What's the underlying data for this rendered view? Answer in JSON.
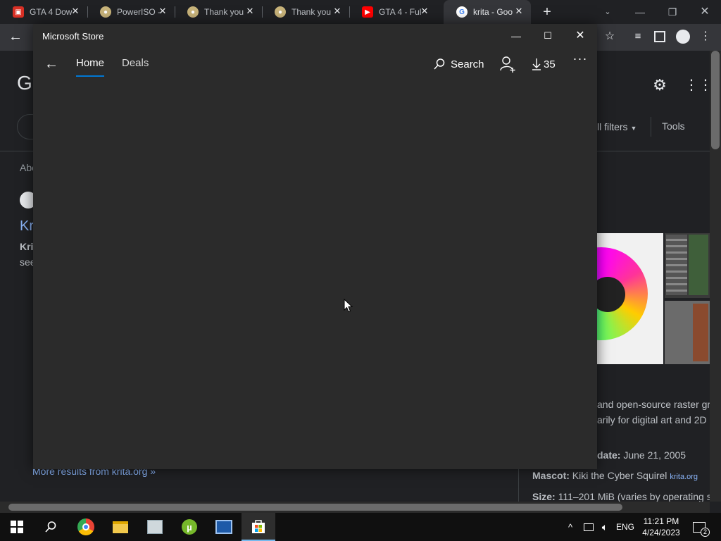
{
  "browser": {
    "tabs": [
      {
        "title": "GTA 4 Dow",
        "icon": "red-app-icon",
        "color": "#d93025"
      },
      {
        "title": "PowerISO -",
        "icon": "disc-icon",
        "color": "#c8b37a"
      },
      {
        "title": "Thank you",
        "icon": "disc-icon",
        "color": "#c8b37a"
      },
      {
        "title": "Thank you",
        "icon": "disc-icon",
        "color": "#c8b37a"
      },
      {
        "title": "GTA 4 - Ful",
        "icon": "youtube-icon",
        "color": "#ff0000"
      },
      {
        "title": "krita - Goo",
        "icon": "google-icon",
        "color": "#4285f4"
      }
    ],
    "new_tab_symbol": "+",
    "search_page": {
      "logo_letter": "G",
      "filters_label": "ll filters",
      "tools_label": "Tools",
      "about_fragment": "Abo",
      "result_title_fragment": "Kr",
      "result_bold_fragment": "Kri",
      "result_line_fragment": "see",
      "more_results": "More results from krita.org »",
      "kp_desc_line1": "and open-source raster gra",
      "kp_desc_line2": "arily for digital art and 2D a",
      "kp_release_label": "date:",
      "kp_release_value": "June 21, 2005",
      "kp_mascot_label": "Mascot:",
      "kp_mascot_value": "Kiki the Cyber Squirel",
      "kp_mascot_source": "krita.org",
      "kp_size_label": "Size:",
      "kp_size_value": "111–201 MiB (varies by operating s"
    }
  },
  "store": {
    "window_title": "Microsoft Store",
    "nav": {
      "home": "Home",
      "deals": "Deals",
      "search": "Search",
      "downloads_count": "35"
    },
    "accent": "#0078d4"
  },
  "taskbar": {
    "language": "ENG",
    "time": "11:21 PM",
    "date": "4/24/2023",
    "notification_count": "2"
  }
}
